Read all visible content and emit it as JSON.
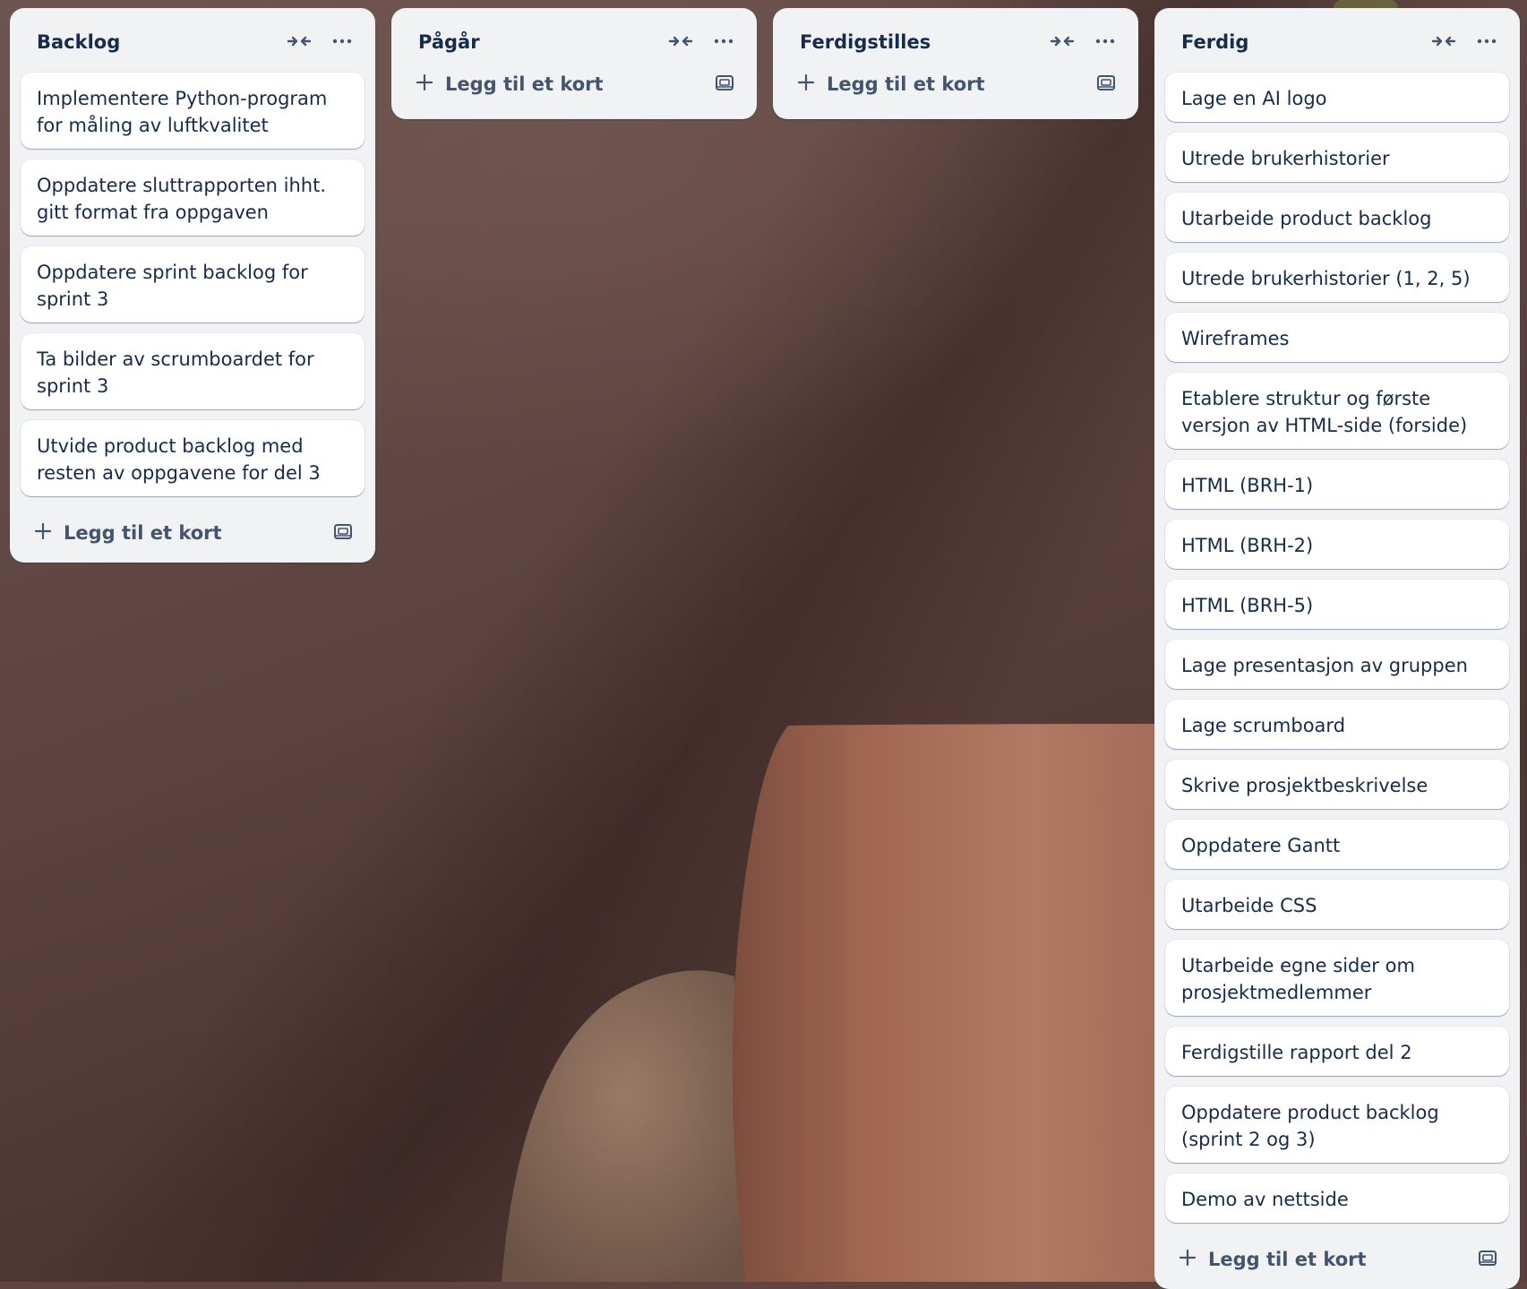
{
  "board": {
    "lists": [
      {
        "title": "Backlog",
        "cards": [
          "Implementere Python-program for måling av luftkvalitet",
          "Oppdatere sluttrapporten ihht. gitt format fra oppgaven",
          "Oppdatere sprint backlog for sprint 3",
          "Ta bilder av scrumboardet for sprint 3",
          "Utvide product backlog med resten av oppgavene for del 3"
        ],
        "add_card_label": "Legg til et kort"
      },
      {
        "title": "Pågår",
        "cards": [],
        "add_card_label": "Legg til et kort"
      },
      {
        "title": "Ferdigstilles",
        "cards": [],
        "add_card_label": "Legg til et kort"
      },
      {
        "title": "Ferdig",
        "cards": [
          "Lage en AI logo",
          "Utrede brukerhistorier",
          "Utarbeide product backlog",
          "Utrede brukerhistorier (1, 2, 5)",
          "Wireframes",
          "Etablere struktur og første versjon av HTML-side (forside)",
          "HTML (BRH-1)",
          "HTML (BRH-2)",
          "HTML (BRH-5)",
          "Lage presentasjon av gruppen",
          "Lage scrumboard",
          "Skrive prosjektbeskrivelse",
          "Oppdatere Gantt",
          "Utarbeide CSS",
          "Utarbeide egne sider om prosjektmedlemmer",
          "Ferdigstille rapport del 2",
          "Oppdatere product backlog (sprint 2 og 3)",
          "Demo av nettside"
        ],
        "add_card_label": "Legg til et kort"
      }
    ]
  },
  "icons": {
    "collapse": "collapse-list-icon",
    "more": "more-options-icon",
    "add": "plus-icon",
    "template": "card-template-icon"
  },
  "colors": {
    "list_background": "#f1f2f4",
    "card_background": "#ffffff",
    "text_primary": "#172b4d",
    "text_secondary": "#44546f"
  }
}
